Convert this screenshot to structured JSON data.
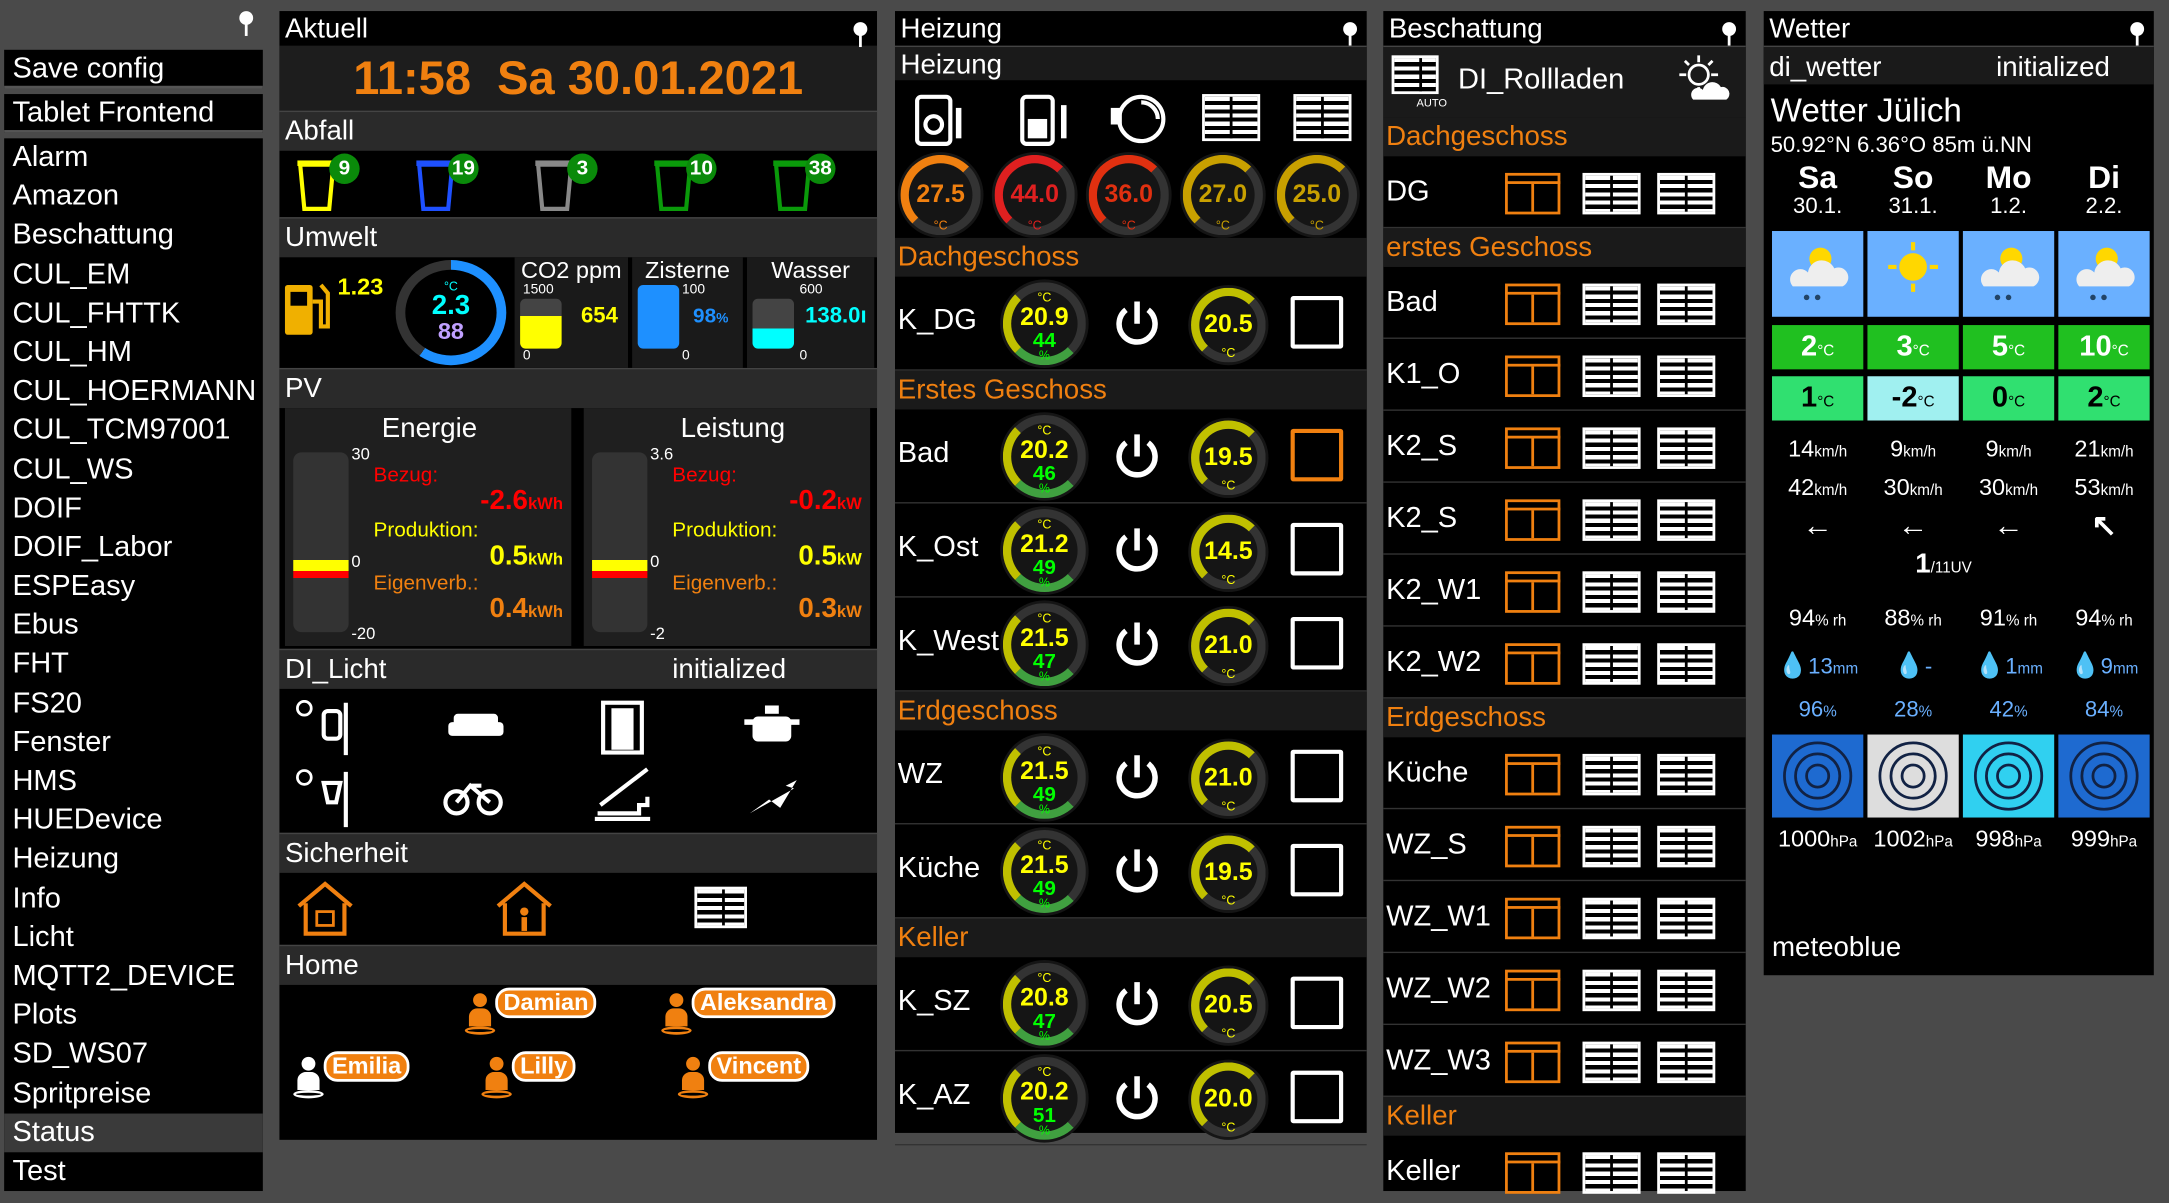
{
  "sidebar": {
    "buttons": [
      "Save config",
      "Tablet Frontend"
    ],
    "items": [
      "Alarm",
      "Amazon",
      "Beschattung",
      "CUL_EM",
      "CUL_FHTTK",
      "CUL_HM",
      "CUL_HOERMANN",
      "CUL_TCM97001",
      "CUL_WS",
      "DOIF",
      "DOIF_Labor",
      "ESPEasy",
      "Ebus",
      "FHT",
      "FS20",
      "Fenster",
      "HMS",
      "HUEDevice",
      "Heizung",
      "Info",
      "Licht",
      "MQTT2_DEVICE",
      "Plots",
      "SD_WS07",
      "Spritpreise",
      "Status",
      "Test"
    ],
    "active": "Status"
  },
  "aktuell": {
    "title": "Aktuell",
    "time": "11:58",
    "date": "Sa 30.01.2021",
    "abfall_title": "Abfall",
    "abfall": [
      "9",
      "19",
      "3",
      "10",
      "38"
    ],
    "umwelt_title": "Umwelt",
    "fuel": "1.23",
    "temp": "2.3",
    "hum": "88",
    "co2_label": "CO2 ppm",
    "co2_max": "1500",
    "co2": "654",
    "zist_label": "Zisterne",
    "zist_max": "100",
    "zist": "98",
    "wasser_label": "Wasser",
    "wasser_max": "600",
    "wasser": "138.0ı",
    "zero": "0",
    "pv_title": "PV",
    "energie": {
      "title": "Energie",
      "max": "30",
      "mid": "0",
      "min": "-20",
      "bezug_label": "Bezug:",
      "bezug": "-2.6",
      "bezug_unit": "kWh",
      "prod_label": "Produktion:",
      "prod": "0.5",
      "prod_unit": "kWh",
      "eigen_label": "Eigenverb.:",
      "eigen": "0.4",
      "eigen_unit": "kWh"
    },
    "leistung": {
      "title": "Leistung",
      "max": "3.6",
      "mid": "0",
      "min": "-2",
      "bezug_label": "Bezug:",
      "bezug": "-0.2",
      "bezug_unit": "kW",
      "prod_label": "Produktion:",
      "prod": "0.5",
      "prod_unit": "kW",
      "eigen_label": "Eigenverb.:",
      "eigen": "0.3",
      "eigen_unit": "kW"
    },
    "licht_title": "DI_Licht",
    "licht_status": "initialized",
    "sicherheit_title": "Sicherheit",
    "home_title": "Home",
    "persons": [
      "Damian",
      "Aleksandra",
      "Emilia",
      "Lilly",
      "Vincent"
    ]
  },
  "heizung": {
    "title": "Heizung",
    "sub": "Heizung",
    "top_temps": [
      "27.5",
      "44.0",
      "36.0",
      "27.0",
      "25.0"
    ],
    "deg_unit": "°C",
    "pct_unit": "%",
    "sections": [
      {
        "name": "Dachgeschoss",
        "rooms": [
          {
            "n": "K_DG",
            "t": "20.9",
            "h": "44",
            "s": "20.5"
          }
        ]
      },
      {
        "name": "Erstes Geschoss",
        "rooms": [
          {
            "n": "Bad",
            "t": "20.2",
            "h": "46",
            "s": "19.5"
          },
          {
            "n": "K_Ost",
            "t": "21.2",
            "h": "49",
            "s": "14.5"
          },
          {
            "n": "K_West",
            "t": "21.5",
            "h": "47",
            "s": "21.0"
          }
        ]
      },
      {
        "name": "Erdgeschoss",
        "rooms": [
          {
            "n": "WZ",
            "t": "21.5",
            "h": "49",
            "s": "21.0"
          },
          {
            "n": "Küche",
            "t": "21.5",
            "h": "49",
            "s": "19.5"
          }
        ]
      },
      {
        "name": "Keller",
        "rooms": [
          {
            "n": "K_SZ",
            "t": "20.8",
            "h": "47",
            "s": "20.5"
          },
          {
            "n": "K_AZ",
            "t": "20.2",
            "h": "51",
            "s": "20.0"
          }
        ]
      }
    ]
  },
  "beschattung": {
    "title": "Beschattung",
    "device": "DI_Rollladen",
    "auto": "AUTO",
    "sections": [
      {
        "name": "Dachgeschoss",
        "rooms": [
          "DG"
        ]
      },
      {
        "name": "erstes Geschoss",
        "rooms": [
          "Bad",
          "K1_O",
          "K2_S",
          "K2_S",
          "K2_W1",
          "K2_W2"
        ]
      },
      {
        "name": "Erdgeschoss",
        "rooms": [
          "Küche",
          "WZ_S",
          "WZ_W1",
          "WZ_W2",
          "WZ_W3"
        ]
      },
      {
        "name": "Keller",
        "rooms": [
          "Keller"
        ]
      }
    ]
  },
  "wetter": {
    "title": "Wetter",
    "device": "di_wetter",
    "status": "initialized",
    "place": "Wetter Jülich",
    "coords": "50.92°N 6.36°O 85m ü.NN",
    "days": [
      {
        "d": "Sa",
        "date": "30.1.",
        "hi": "2",
        "lo": "1",
        "w1": "14",
        "w2": "42",
        "rh": "94",
        "rain": "13",
        "rain_u": "mm",
        "p": "96",
        "hpa": "1000"
      },
      {
        "d": "So",
        "date": "31.1.",
        "hi": "3",
        "lo": "-2",
        "w1": "9",
        "w2": "30",
        "rh": "88",
        "rain": "-",
        "rain_u": "",
        "p": "28",
        "hpa": "1002"
      },
      {
        "d": "Mo",
        "date": "1.2.",
        "hi": "5",
        "lo": "0",
        "w1": "9",
        "w2": "30",
        "rh": "91",
        "rain": "1",
        "rain_u": "mm",
        "p": "42",
        "hpa": "998"
      },
      {
        "d": "Di",
        "date": "2.2.",
        "hi": "10",
        "lo": "2",
        "w1": "21",
        "w2": "53",
        "rh": "94",
        "rain": "9",
        "rain_u": "mm",
        "p": "84",
        "hpa": "999"
      }
    ],
    "uv": "1",
    "uv_u": "/11UV",
    "temp_u": "°C",
    "wind_u": "km/h",
    "rh_u": "% rh",
    "pct_u": "%",
    "hpa_u": "hPa",
    "footer": "meteoblue"
  }
}
